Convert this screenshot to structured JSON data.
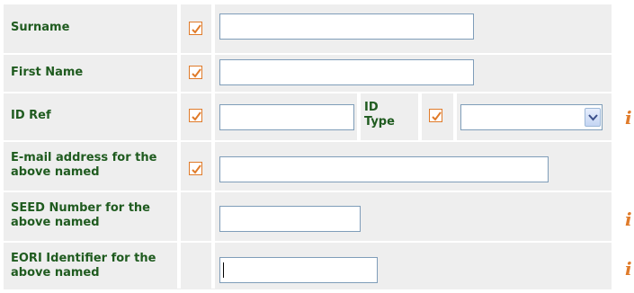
{
  "colors": {
    "label_text": "#1f5b1f",
    "row_bg": "#eeeeee",
    "check_orange": "#e07b2a",
    "input_border": "#7f9db9"
  },
  "rows": [
    {
      "label": "Surname",
      "required": true,
      "value": ""
    },
    {
      "label": "First Name",
      "required": true,
      "value": ""
    },
    {
      "label": "ID Ref",
      "required": true,
      "value": "",
      "id_type_label": "ID Type",
      "id_type_required": true,
      "id_type_selected": ""
    },
    {
      "label": "E-mail address for the above named",
      "required": true,
      "value": ""
    },
    {
      "label": "SEED Number for the above named",
      "required": false,
      "value": ""
    },
    {
      "label": "EORI Identifier for the above named",
      "required": false,
      "value": ""
    }
  ],
  "icons": {
    "check": "check-icon",
    "info": "info-icon",
    "dropdown": "chevron-down-icon"
  },
  "info_glyph": "i"
}
